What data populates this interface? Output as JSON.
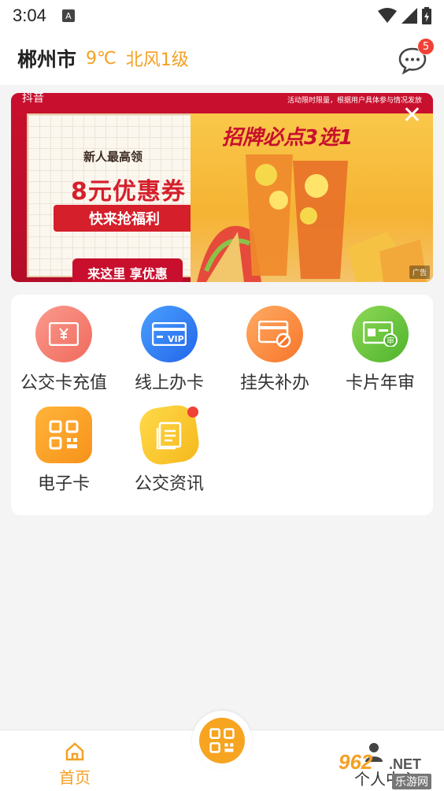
{
  "status_bar": {
    "time": "3:04",
    "notification_icon": "A"
  },
  "header": {
    "city": "郴州市",
    "temperature": "9℃",
    "wind": "北风1级",
    "message_badge": "5",
    "accent_color": "#f5a023"
  },
  "banner": {
    "logo_text": "抖音",
    "note": "活动限时限量，根据用户具体参与情况发放",
    "coupon_line1": "新人最高领",
    "coupon_line2": "8元优惠券",
    "coupon_pill": "快来抢福利",
    "coupon_button": "来这里 享优惠",
    "promo_title": "招牌必点3选1",
    "ad_tag": "广告"
  },
  "services": [
    {
      "label": "公交卡充值",
      "icon": "card-yuan-icon",
      "color": "#f47a6c"
    },
    {
      "label": "线上办卡",
      "icon": "vip-card-icon",
      "color": "#2e7ef6"
    },
    {
      "label": "挂失补办",
      "icon": "card-block-icon",
      "color": "#fb8a3c"
    },
    {
      "label": "卡片年审",
      "icon": "card-review-icon",
      "color": "#5fc23b"
    },
    {
      "label": "电子卡",
      "icon": "qrcode-icon",
      "color": "#f7a420"
    },
    {
      "label": "公交资讯",
      "icon": "news-icon",
      "color": "#f7c52c"
    }
  ],
  "bottom_nav": {
    "home_label": "首页",
    "mine_label": "个人中心",
    "active_color": "#f5a023"
  },
  "watermark": {
    "main": "962",
    "net": ".NET",
    "sub": "乐游网"
  }
}
